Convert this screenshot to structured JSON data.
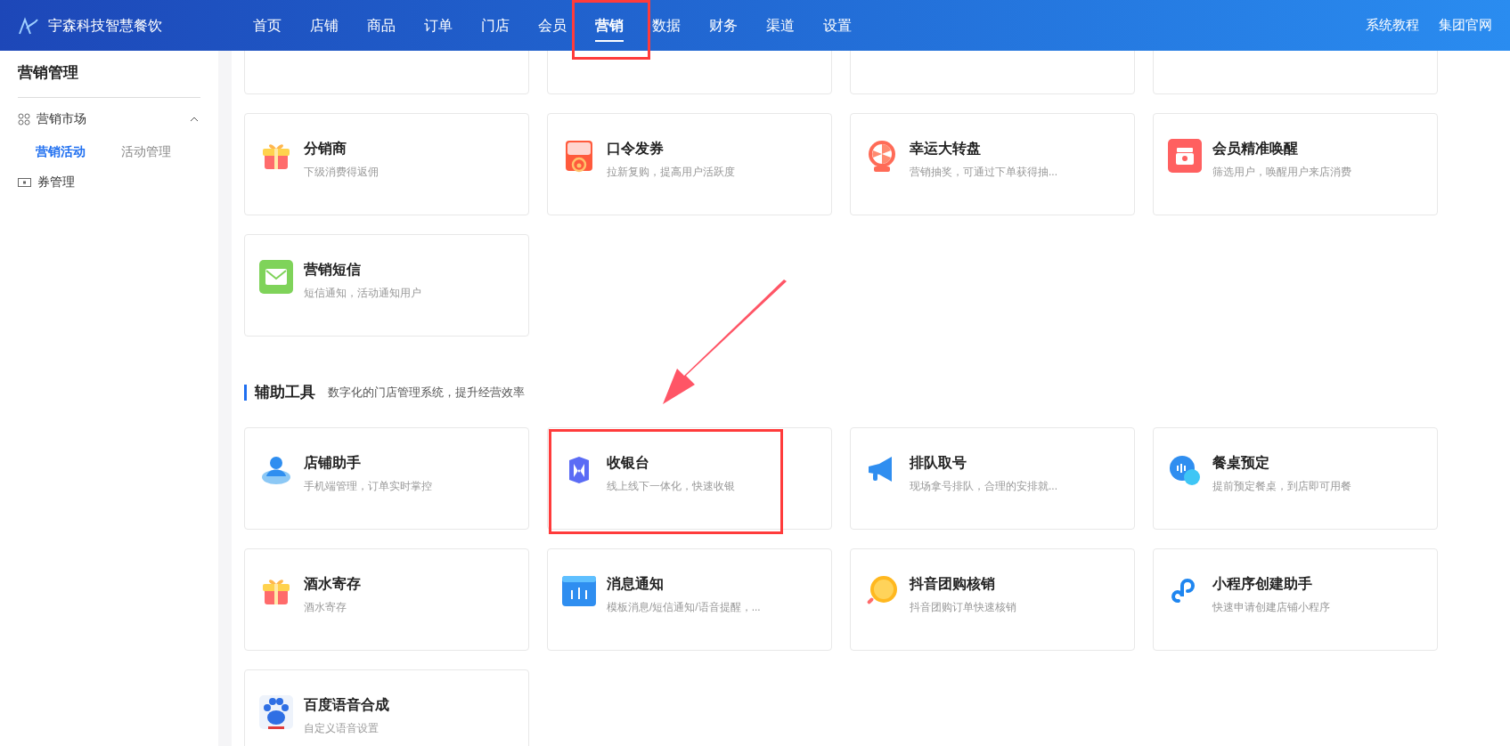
{
  "header": {
    "brand": "宇森科技智慧餐饮",
    "nav": [
      {
        "label": "首页",
        "selected": false
      },
      {
        "label": "店铺",
        "selected": false
      },
      {
        "label": "商品",
        "selected": false
      },
      {
        "label": "订单",
        "selected": false
      },
      {
        "label": "门店",
        "selected": false
      },
      {
        "label": "会员",
        "selected": false
      },
      {
        "label": "营销",
        "selected": true
      },
      {
        "label": "数据",
        "selected": false
      },
      {
        "label": "财务",
        "selected": false
      },
      {
        "label": "渠道",
        "selected": false
      },
      {
        "label": "设置",
        "selected": false
      }
    ],
    "links": [
      "系统教程",
      "集团官网"
    ]
  },
  "sidebar": {
    "title": "营销管理",
    "items": [
      {
        "label": "营销市场",
        "kind": "grid",
        "expanded": true,
        "children": [
          {
            "label": "营销活动",
            "selected": true
          },
          {
            "label": "活动管理",
            "selected": false
          }
        ]
      },
      {
        "label": "券管理",
        "kind": "ticket",
        "expanded": false
      }
    ]
  },
  "marketing_cards": [
    {
      "kind": "blank"
    },
    {
      "kind": "blank"
    },
    {
      "kind": "blank"
    },
    {
      "kind": "blank"
    },
    {
      "title": "分销商",
      "description": "下级消费得返佣",
      "kind": "gift"
    },
    {
      "title": "口令发券",
      "description": "拉新复购，提高用户活跃度",
      "kind": "envelope"
    },
    {
      "title": "幸运大转盘",
      "description": "营销抽奖，可通过下单获得抽...",
      "kind": "wheel"
    },
    {
      "title": "会员精准唤醒",
      "description": "筛选用户，唤醒用户来店消费",
      "kind": "wake"
    },
    {
      "title": "营销短信",
      "description": "短信通知，活动通知用户",
      "kind": "sms"
    }
  ],
  "tools_section": {
    "title": "辅助工具",
    "subtitle": "数字化的门店管理系统，提升经营效率"
  },
  "tool_cards": [
    {
      "title": "店铺助手",
      "description": "手机端管理，订单实时掌控",
      "kind": "assistant"
    },
    {
      "title": "收银台",
      "description": "线上线下一体化，快速收银",
      "kind": "cashier"
    },
    {
      "title": "排队取号",
      "description": "现场拿号排队，合理的安排就...",
      "kind": "megaphone"
    },
    {
      "title": "餐桌预定",
      "description": "提前预定餐桌，到店即可用餐",
      "kind": "chat"
    },
    {
      "title": "酒水寄存",
      "description": "酒水寄存",
      "kind": "gift"
    },
    {
      "title": "消息通知",
      "description": "模板消息/短信通知/语音提醒，...",
      "kind": "message"
    },
    {
      "title": "抖音团购核销",
      "description": "抖音团购订单快速核销",
      "kind": "coin"
    },
    {
      "title": "小程序创建助手",
      "description": "快速申请创建店铺小程序",
      "kind": "link"
    },
    {
      "title": "百度语音合成",
      "description": "自定义语音设置",
      "kind": "paw"
    }
  ]
}
